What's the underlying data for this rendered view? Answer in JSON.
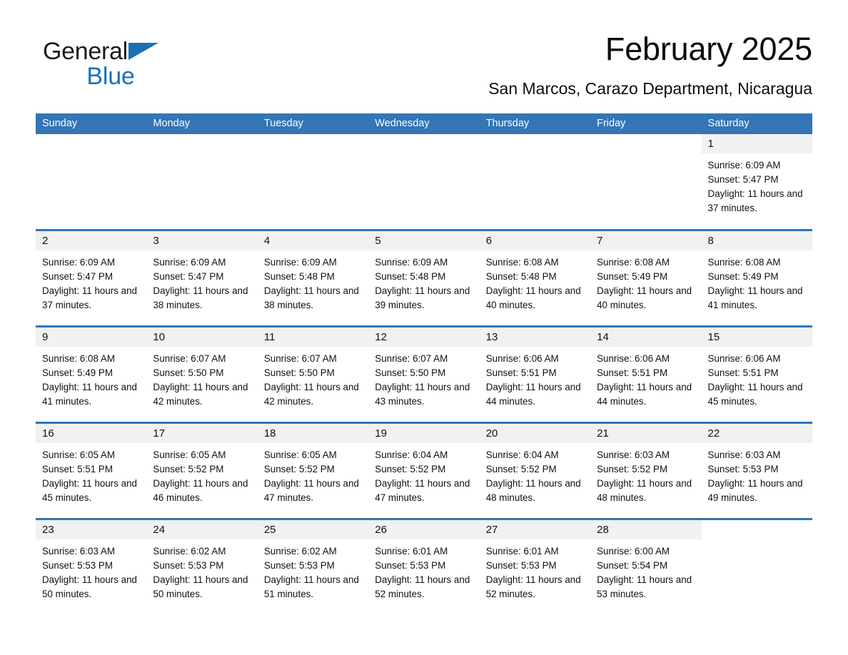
{
  "brand": {
    "name_part1": "General",
    "name_part2": "Blue",
    "triangle_color": "#1a71b8"
  },
  "header": {
    "title": "February 2025",
    "subtitle": "San Marcos, Carazo Department, Nicaragua",
    "accent_color": "#3375b5"
  },
  "weekdays": [
    "Sunday",
    "Monday",
    "Tuesday",
    "Wednesday",
    "Thursday",
    "Friday",
    "Saturday"
  ],
  "labels": {
    "sunrise_prefix": "Sunrise: ",
    "sunset_prefix": "Sunset: ",
    "daylight_prefix": "Daylight: "
  },
  "weeks": [
    [
      {
        "day": "",
        "blank": true
      },
      {
        "day": "",
        "blank": true
      },
      {
        "day": "",
        "blank": true
      },
      {
        "day": "",
        "blank": true
      },
      {
        "day": "",
        "blank": true
      },
      {
        "day": "",
        "blank": true
      },
      {
        "day": "1",
        "sunrise": "Sunrise: 6:09 AM",
        "sunset": "Sunset: 5:47 PM",
        "daylight": "Daylight: 11 hours and 37 minutes."
      }
    ],
    [
      {
        "day": "2",
        "sunrise": "Sunrise: 6:09 AM",
        "sunset": "Sunset: 5:47 PM",
        "daylight": "Daylight: 11 hours and 37 minutes."
      },
      {
        "day": "3",
        "sunrise": "Sunrise: 6:09 AM",
        "sunset": "Sunset: 5:47 PM",
        "daylight": "Daylight: 11 hours and 38 minutes."
      },
      {
        "day": "4",
        "sunrise": "Sunrise: 6:09 AM",
        "sunset": "Sunset: 5:48 PM",
        "daylight": "Daylight: 11 hours and 38 minutes."
      },
      {
        "day": "5",
        "sunrise": "Sunrise: 6:09 AM",
        "sunset": "Sunset: 5:48 PM",
        "daylight": "Daylight: 11 hours and 39 minutes."
      },
      {
        "day": "6",
        "sunrise": "Sunrise: 6:08 AM",
        "sunset": "Sunset: 5:48 PM",
        "daylight": "Daylight: 11 hours and 40 minutes."
      },
      {
        "day": "7",
        "sunrise": "Sunrise: 6:08 AM",
        "sunset": "Sunset: 5:49 PM",
        "daylight": "Daylight: 11 hours and 40 minutes."
      },
      {
        "day": "8",
        "sunrise": "Sunrise: 6:08 AM",
        "sunset": "Sunset: 5:49 PM",
        "daylight": "Daylight: 11 hours and 41 minutes."
      }
    ],
    [
      {
        "day": "9",
        "sunrise": "Sunrise: 6:08 AM",
        "sunset": "Sunset: 5:49 PM",
        "daylight": "Daylight: 11 hours and 41 minutes."
      },
      {
        "day": "10",
        "sunrise": "Sunrise: 6:07 AM",
        "sunset": "Sunset: 5:50 PM",
        "daylight": "Daylight: 11 hours and 42 minutes."
      },
      {
        "day": "11",
        "sunrise": "Sunrise: 6:07 AM",
        "sunset": "Sunset: 5:50 PM",
        "daylight": "Daylight: 11 hours and 42 minutes."
      },
      {
        "day": "12",
        "sunrise": "Sunrise: 6:07 AM",
        "sunset": "Sunset: 5:50 PM",
        "daylight": "Daylight: 11 hours and 43 minutes."
      },
      {
        "day": "13",
        "sunrise": "Sunrise: 6:06 AM",
        "sunset": "Sunset: 5:51 PM",
        "daylight": "Daylight: 11 hours and 44 minutes."
      },
      {
        "day": "14",
        "sunrise": "Sunrise: 6:06 AM",
        "sunset": "Sunset: 5:51 PM",
        "daylight": "Daylight: 11 hours and 44 minutes."
      },
      {
        "day": "15",
        "sunrise": "Sunrise: 6:06 AM",
        "sunset": "Sunset: 5:51 PM",
        "daylight": "Daylight: 11 hours and 45 minutes."
      }
    ],
    [
      {
        "day": "16",
        "sunrise": "Sunrise: 6:05 AM",
        "sunset": "Sunset: 5:51 PM",
        "daylight": "Daylight: 11 hours and 45 minutes."
      },
      {
        "day": "17",
        "sunrise": "Sunrise: 6:05 AM",
        "sunset": "Sunset: 5:52 PM",
        "daylight": "Daylight: 11 hours and 46 minutes."
      },
      {
        "day": "18",
        "sunrise": "Sunrise: 6:05 AM",
        "sunset": "Sunset: 5:52 PM",
        "daylight": "Daylight: 11 hours and 47 minutes."
      },
      {
        "day": "19",
        "sunrise": "Sunrise: 6:04 AM",
        "sunset": "Sunset: 5:52 PM",
        "daylight": "Daylight: 11 hours and 47 minutes."
      },
      {
        "day": "20",
        "sunrise": "Sunrise: 6:04 AM",
        "sunset": "Sunset: 5:52 PM",
        "daylight": "Daylight: 11 hours and 48 minutes."
      },
      {
        "day": "21",
        "sunrise": "Sunrise: 6:03 AM",
        "sunset": "Sunset: 5:52 PM",
        "daylight": "Daylight: 11 hours and 48 minutes."
      },
      {
        "day": "22",
        "sunrise": "Sunrise: 6:03 AM",
        "sunset": "Sunset: 5:53 PM",
        "daylight": "Daylight: 11 hours and 49 minutes."
      }
    ],
    [
      {
        "day": "23",
        "sunrise": "Sunrise: 6:03 AM",
        "sunset": "Sunset: 5:53 PM",
        "daylight": "Daylight: 11 hours and 50 minutes."
      },
      {
        "day": "24",
        "sunrise": "Sunrise: 6:02 AM",
        "sunset": "Sunset: 5:53 PM",
        "daylight": "Daylight: 11 hours and 50 minutes."
      },
      {
        "day": "25",
        "sunrise": "Sunrise: 6:02 AM",
        "sunset": "Sunset: 5:53 PM",
        "daylight": "Daylight: 11 hours and 51 minutes."
      },
      {
        "day": "26",
        "sunrise": "Sunrise: 6:01 AM",
        "sunset": "Sunset: 5:53 PM",
        "daylight": "Daylight: 11 hours and 52 minutes."
      },
      {
        "day": "27",
        "sunrise": "Sunrise: 6:01 AM",
        "sunset": "Sunset: 5:53 PM",
        "daylight": "Daylight: 11 hours and 52 minutes."
      },
      {
        "day": "28",
        "sunrise": "Sunrise: 6:00 AM",
        "sunset": "Sunset: 5:54 PM",
        "daylight": "Daylight: 11 hours and 53 minutes."
      },
      {
        "day": "",
        "blank": true
      }
    ]
  ]
}
